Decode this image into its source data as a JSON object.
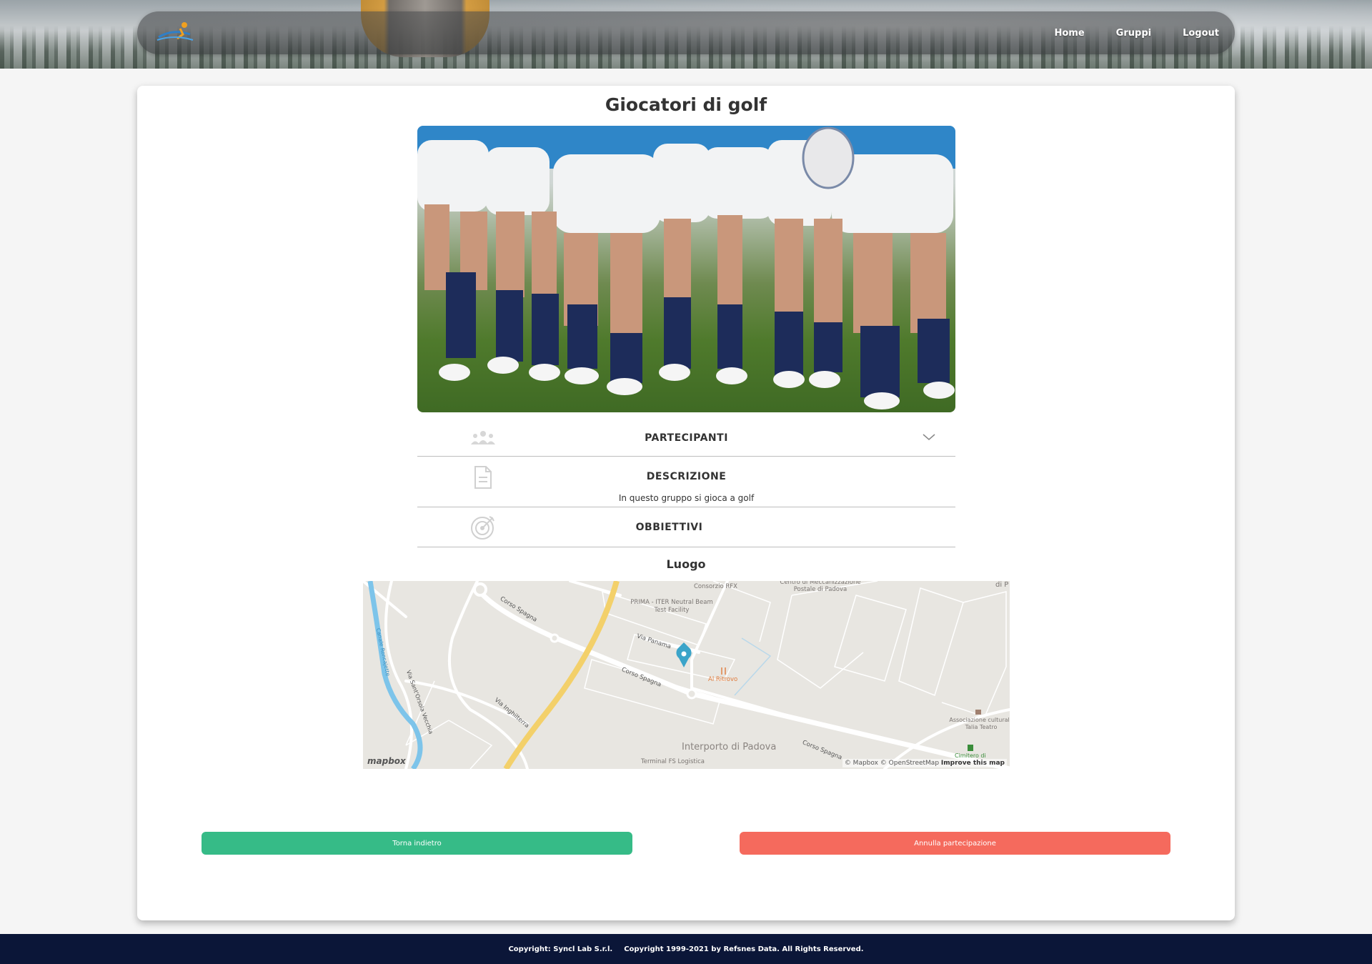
{
  "nav": {
    "links": [
      "Home",
      "Gruppi",
      "Logout"
    ]
  },
  "group": {
    "title": "Giocatori di golf"
  },
  "sections": {
    "partecipanti": {
      "title": "PARTECIPANTI"
    },
    "descrizione": {
      "title": "DESCRIZIONE",
      "text": "In questo gruppo si gioca a golf"
    },
    "obbiettivi": {
      "title": "OBBIETTIVI"
    }
  },
  "location": {
    "label": "Luogo",
    "map": {
      "streets": [
        "Corso Spagna",
        "Via Panama",
        "Corso Spagna",
        "Via Inghilterra",
        "Corso Spagna",
        "Via Sant'Orsola Vecchia",
        "Canale Roncajette"
      ],
      "places": [
        "Consorzio RFX",
        "Centro di Meccanizzazione Postale di Padova",
        "PRIMA - ITER Neutral Beam Test Facility",
        "Al Ritrovo",
        "Interporto di Padova",
        "Terminal FS Logistica",
        "Associazione culturale Talia Teatro",
        "Cimitero di",
        "di P"
      ],
      "attribution": "© Mapbox © OpenStreetMap",
      "improve": "Improve this map",
      "logo": "mapbox"
    }
  },
  "buttons": {
    "back": "Torna indietro",
    "cancel": "Annulla partecipazione"
  },
  "footer": {
    "copyright1": "Copyright: Syncl Lab S.r.l.",
    "copyright2": "Copyright 1999-2021 by Refsnes Data. All Rights Reserved."
  },
  "colors": {
    "back_button": "#36bb87",
    "cancel_button": "#f56a5d",
    "footer": "#0b1638",
    "map_marker": "#3ba4c9"
  }
}
